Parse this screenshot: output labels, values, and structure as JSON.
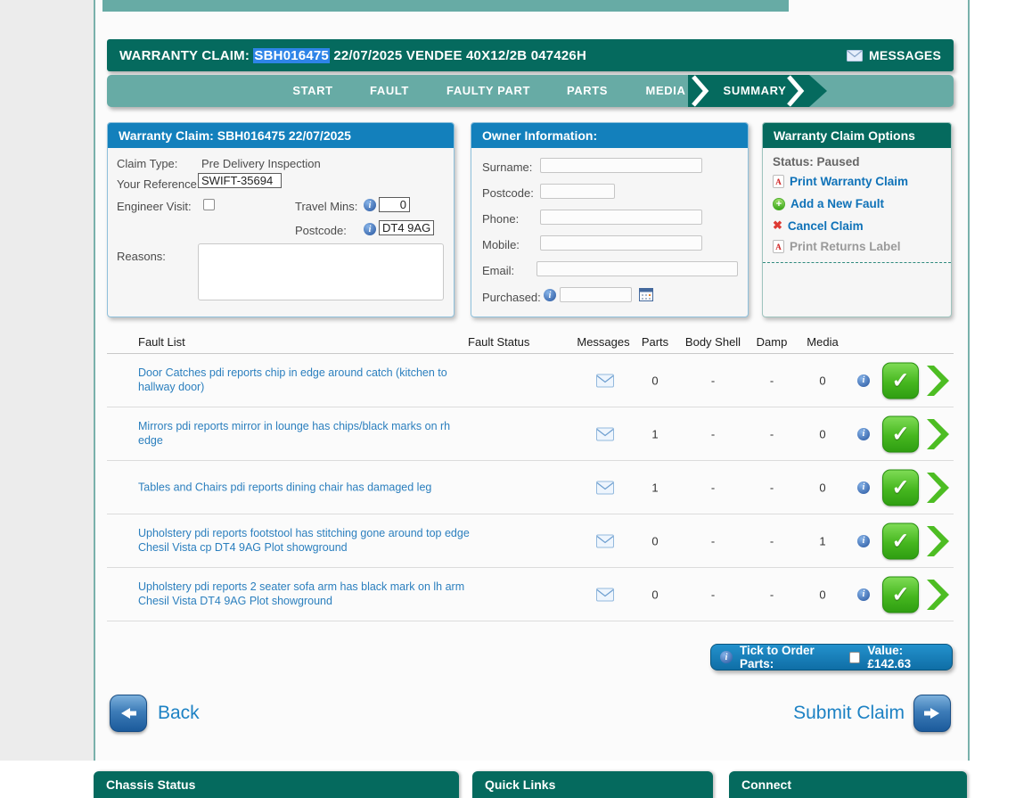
{
  "header": {
    "title_prefix": "WARRANTY CLAIM: ",
    "title_selected": "SBH016475",
    "title_suffix": " 22/07/2025 VENDEE 40X12/2B 047426H",
    "messages_label": "MESSAGES"
  },
  "nav": {
    "tabs": [
      {
        "label": "START"
      },
      {
        "label": "FAULT"
      },
      {
        "label": "FAULTY PART"
      },
      {
        "label": "PARTS"
      },
      {
        "label": "MEDIA"
      },
      {
        "label": "SUMMARY",
        "active": true
      }
    ]
  },
  "claim_panel": {
    "title": "Warranty Claim: SBH016475 22/07/2025",
    "claim_type_label": "Claim Type:",
    "claim_type_value": "Pre Delivery Inspection",
    "your_reference_label": "Your Reference:",
    "your_reference_value": "SWIFT-35694",
    "engineer_visit_label": "Engineer Visit:",
    "travel_mins_label": "Travel Mins:",
    "travel_mins_value": "0",
    "postcode_label": "Postcode:",
    "postcode_value": "DT4 9AG",
    "reasons_label": "Reasons:"
  },
  "owner_panel": {
    "title": "Owner Information:",
    "fields": [
      "Surname:",
      "Postcode:",
      "Phone:",
      "Mobile:",
      "Email:"
    ],
    "purchased_label": "Purchased:"
  },
  "options_panel": {
    "title": "Warranty Claim Options",
    "status": "Status: Paused",
    "print_claim": "Print Warranty Claim",
    "add_fault": "Add a New Fault",
    "cancel_claim": "Cancel Claim",
    "print_returns": "Print Returns Label"
  },
  "fault_table": {
    "headers": {
      "fault_list": "Fault List",
      "fault_status": "Fault Status",
      "messages": "Messages",
      "parts": "Parts",
      "body_shell": "Body Shell",
      "damp": "Damp",
      "media": "Media"
    },
    "rows": [
      {
        "text": "Door Catches pdi reports chip in edge around catch (kitchen to\nhallway door)",
        "parts": "0",
        "body_shell": "-",
        "damp": "-",
        "media": "0"
      },
      {
        "text": "Mirrors pdi reports mirror in lounge has chips/black marks on rh\nedge",
        "parts": "1",
        "body_shell": "-",
        "damp": "-",
        "media": "0"
      },
      {
        "text": "Tables and Chairs pdi reports dining chair has damaged leg",
        "parts": "1",
        "body_shell": "-",
        "damp": "-",
        "media": "0"
      },
      {
        "text": "Upholstery pdi reports footstool has stitching gone around top edge\nChesil Vista cp DT4 9AG Plot showground",
        "parts": "0",
        "body_shell": "-",
        "damp": "-",
        "media": "1"
      },
      {
        "text": "Upholstery pdi reports 2 seater sofa arm has black mark on lh arm\nChesil Vista DT4 9AG Plot showground",
        "parts": "0",
        "body_shell": "-",
        "damp": "-",
        "media": "0"
      }
    ]
  },
  "order_bar": {
    "label": "Tick to Order Parts:",
    "value_label": "Value: £142.63"
  },
  "actions": {
    "back": "Back",
    "submit": "Submit Claim"
  },
  "footer": {
    "chassis": "Chassis Status",
    "quick_links": "Quick Links",
    "connect": "Connect"
  },
  "icons": {
    "info_glyph": "i",
    "check_glyph": "✓",
    "plus_glyph": "+",
    "cancel_glyph": "✖",
    "pdf_glyph": "A"
  },
  "colors": {
    "teal_dark": "#056a5e",
    "teal_light": "#67aba5",
    "blue_header": "#1380bc",
    "link_blue": "#0f72b8",
    "fault_text_blue": "#2b7fbe",
    "green_button": "#46b71f",
    "selection_blue": "#2e84e8"
  }
}
